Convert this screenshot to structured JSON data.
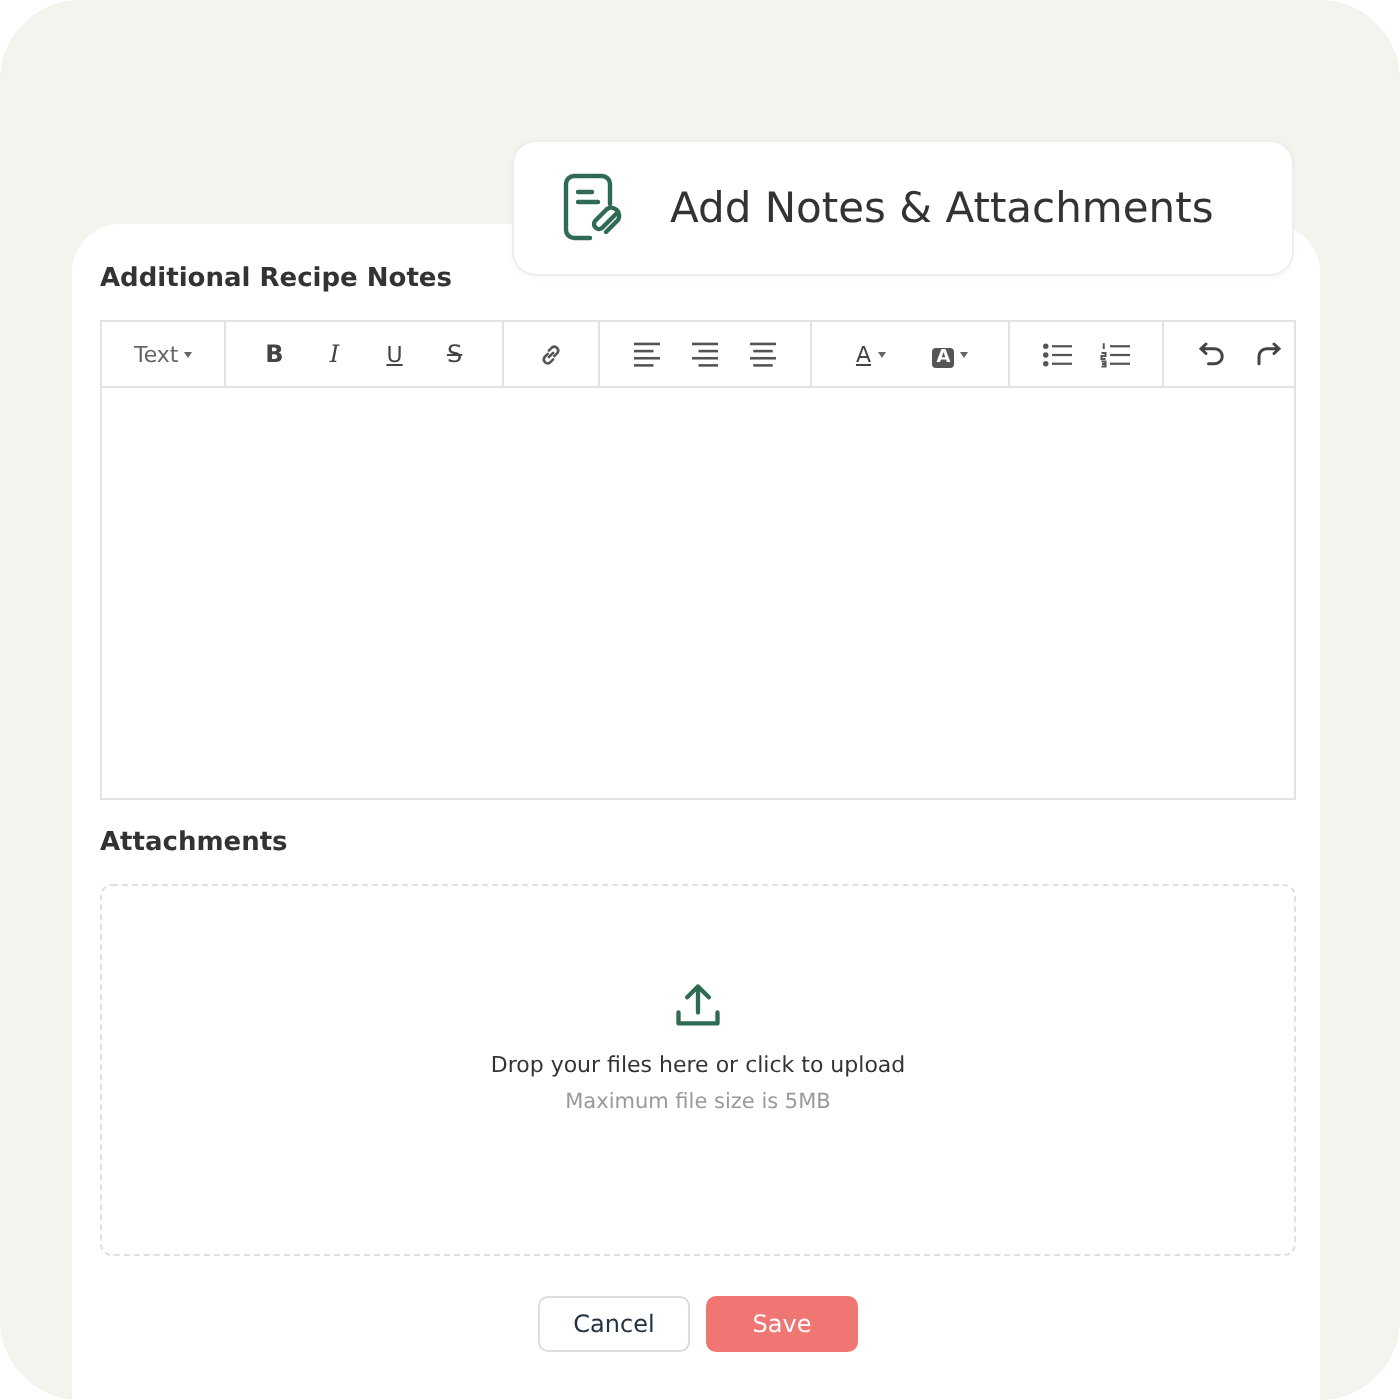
{
  "header": {
    "title": "Add Notes & Attachments"
  },
  "notes": {
    "label": "Additional Recipe Notes",
    "toolbar": [
      [
        {
          "kind": "dropdown",
          "text": "Text"
        }
      ],
      [
        {
          "kind": "bold",
          "text": "B"
        },
        {
          "kind": "italic",
          "text": "I"
        },
        {
          "kind": "underline",
          "text": "U"
        },
        {
          "kind": "strike",
          "text": "S"
        }
      ],
      [
        {
          "kind": "link"
        }
      ],
      [
        {
          "kind": "align-left"
        },
        {
          "kind": "align-right"
        },
        {
          "kind": "align-center"
        }
      ],
      [
        {
          "kind": "color",
          "text": "A"
        },
        {
          "kind": "highlight",
          "text": "A"
        }
      ],
      [
        {
          "kind": "bullets"
        },
        {
          "kind": "numbers"
        }
      ],
      [
        {
          "kind": "undo"
        },
        {
          "kind": "redo"
        }
      ]
    ]
  },
  "attachments": {
    "label": "Attachments",
    "prompt": "Drop your files here or click to upload",
    "hint": "Maximum file size is 5MB"
  },
  "buttons": [
    {
      "kind": "secondary",
      "label": "Cancel"
    },
    {
      "kind": "primary",
      "label": "Save"
    }
  ]
}
